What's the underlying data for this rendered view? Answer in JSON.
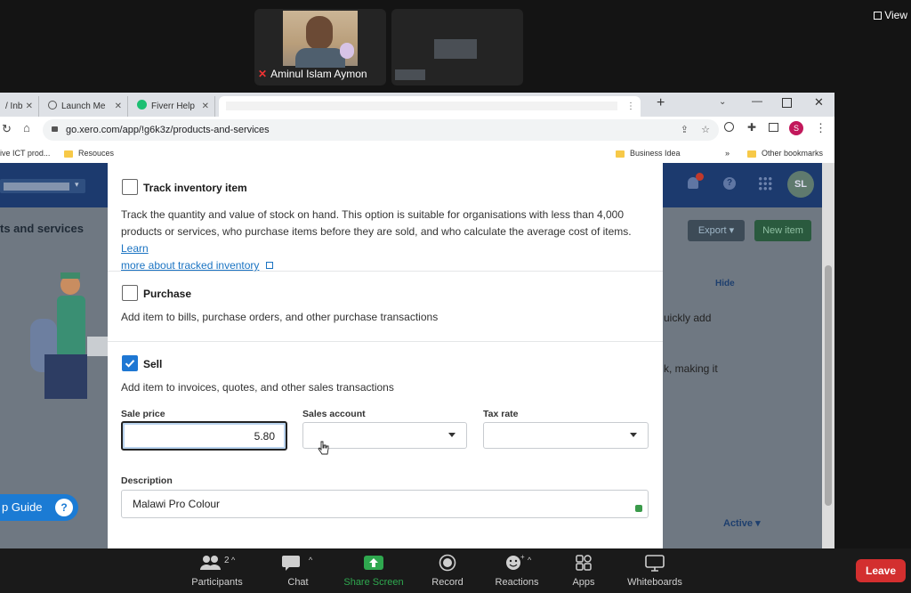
{
  "zoom": {
    "participant_name": "Aminul Islam Aymon",
    "view_label": "View",
    "toolbar": {
      "participants_label": "Participants",
      "participants_count": "2",
      "chat_label": "Chat",
      "share_label": "Share Screen",
      "record_label": "Record",
      "reactions_label": "Reactions",
      "apps_label": "Apps",
      "whiteboards_label": "Whiteboards",
      "leave_label": "Leave"
    },
    "colors": {
      "share_green": "#2fa84f",
      "leave_red": "#d32f2f"
    }
  },
  "browser": {
    "tabs": [
      {
        "label": "/ Inb"
      },
      {
        "label": "Launch Me"
      },
      {
        "label": "Fiverr Help"
      }
    ],
    "url": "go.xero.com/app/!g6k3z/products-and-services",
    "profile_initial": "S",
    "bookmarks": {
      "left1": "ive ICT prod...",
      "left2": "Resouces",
      "right1": "Business Idea",
      "overflow": "»",
      "other": "Other bookmarks"
    }
  },
  "xero": {
    "page_title": "ts and services",
    "export_label": "Export",
    "new_item_label": "New item",
    "hide_label": "Hide",
    "avatar": "SL",
    "bg_text1": "uickly add",
    "bg_text2": "k, making it",
    "active_label": "Active",
    "guide_label": "p Guide",
    "guide_icon": "?"
  },
  "form": {
    "track": {
      "title": "Track inventory item",
      "desc_1": "Track the quantity and value of stock on hand. This option is suitable for organisations with less than 4,000",
      "desc_2": "products or services, who purchase items before they are sold, and who calculate the average cost of items.",
      "link_a": "Learn",
      "link_b": "more about tracked inventory",
      "checked": false
    },
    "purchase": {
      "title": "Purchase",
      "desc": "Add item to bills, purchase orders, and other purchase transactions",
      "checked": false
    },
    "sell": {
      "title": "Sell",
      "desc": "Add item to invoices, quotes, and other sales transactions",
      "checked": true,
      "sale_price_label": "Sale price",
      "sale_price_value": "5.80",
      "sales_account_label": "Sales account",
      "sales_account_value": "",
      "tax_rate_label": "Tax rate",
      "tax_rate_value": "",
      "description_label": "Description",
      "description_value": "Malawi Pro Colour"
    }
  }
}
